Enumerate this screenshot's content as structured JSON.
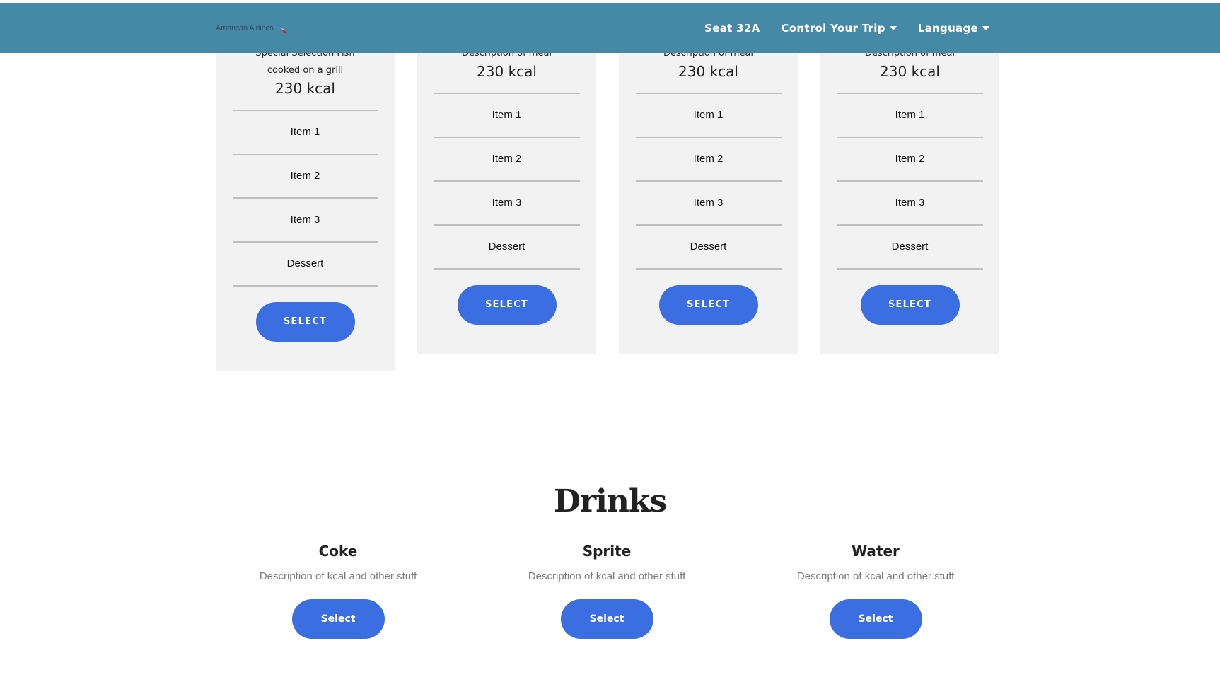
{
  "navbar": {
    "brand_text": "American Airlines",
    "brand_icon": "american-airlines-flag-logo",
    "seat": "Seat 32A",
    "control_trip": "Control Your Trip",
    "language": "Language",
    "background_color": "#4589a6"
  },
  "meals": [
    {
      "description_lines": [
        "Special Selection Fish",
        "cooked on a grill"
      ],
      "kcal": "230 kcal",
      "items": [
        "Item 1",
        "Item 2",
        "Item 3",
        "Dessert"
      ],
      "button": "SELECT"
    },
    {
      "description_lines": [
        "Description of meal"
      ],
      "kcal": "230 kcal",
      "items": [
        "Item 1",
        "Item 2",
        "Item 3",
        "Dessert"
      ],
      "button": "SELECT"
    },
    {
      "description_lines": [
        "Description of meal"
      ],
      "kcal": "230 kcal",
      "items": [
        "Item 1",
        "Item 2",
        "Item 3",
        "Dessert"
      ],
      "button": "SELECT"
    },
    {
      "description_lines": [
        "Description of meal"
      ],
      "kcal": "230 kcal",
      "items": [
        "Item 1",
        "Item 2",
        "Item 3",
        "Dessert"
      ],
      "button": "SELECT"
    }
  ],
  "drinks": {
    "title": "Drinks",
    "items": [
      {
        "name": "Coke",
        "description": "Description of kcal and other stuff",
        "button": "Select"
      },
      {
        "name": "Sprite",
        "description": "Description of kcal and other stuff",
        "button": "Select"
      },
      {
        "name": "Water",
        "description": "Description of kcal and other stuff",
        "button": "Select"
      }
    ]
  },
  "colors": {
    "accent_button": "#3b6ee0",
    "card_background": "#f2f2f2"
  }
}
